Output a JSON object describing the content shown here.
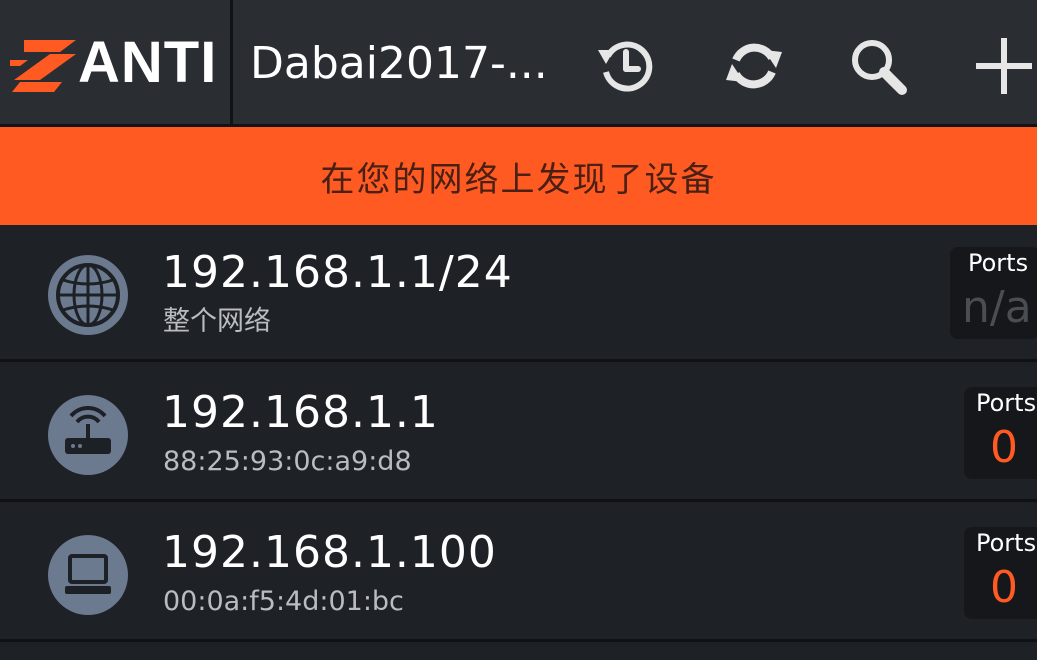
{
  "header": {
    "logo_text": "ANTI",
    "network_title": "Dabai2017-...",
    "icons": [
      "history-icon",
      "refresh-icon",
      "search-icon",
      "add-icon"
    ]
  },
  "banner": {
    "text": "在您的网络上发现了设备"
  },
  "ports_label": "Ports",
  "devices": [
    {
      "title": "192.168.1.1/24",
      "subtitle": "整个网络",
      "icon": "globe-icon",
      "ports": "n/a"
    },
    {
      "title": "192.168.1.1",
      "subtitle": "88:25:93:0c:a9:d8",
      "icon": "router-icon",
      "ports": "0"
    },
    {
      "title": "192.168.1.100",
      "subtitle": "00:0a:f5:4d:01:bc",
      "icon": "computer-icon",
      "ports": "0"
    }
  ],
  "colors": {
    "accent": "#ff5a22",
    "ports_value": "#ff5a22",
    "ports_na": "#4a4d52",
    "avatar_bg": "#6b7a8f"
  }
}
